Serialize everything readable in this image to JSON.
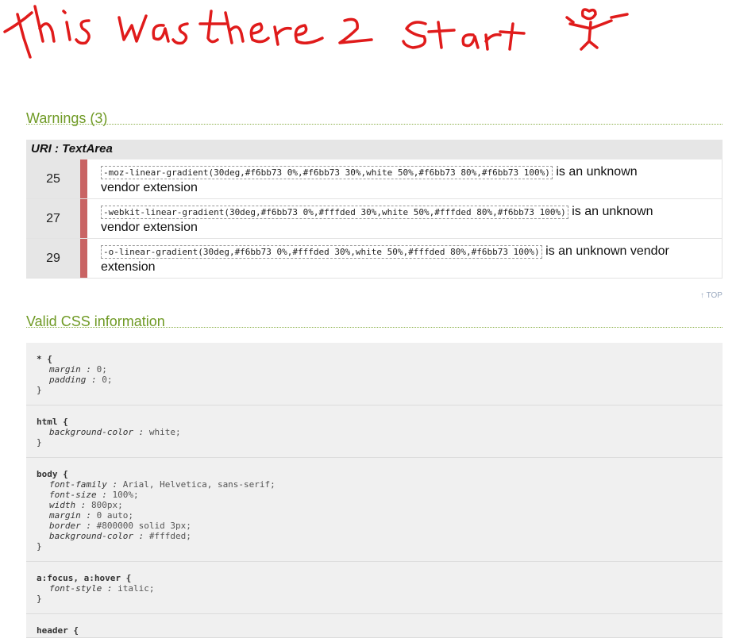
{
  "handwriting": {
    "text": "this was there 2 start"
  },
  "warnings": {
    "title": "Warnings (3)",
    "uri_label": "URI : TextArea",
    "rows": [
      {
        "line": "25",
        "code": "-moz-linear-gradient(30deg,#f6bb73 0%,#f6bb73 30%,white 50%,#f6bb73 80%,#f6bb73 100%)",
        "text_a": " is an unknown",
        "text_b": "vendor extension"
      },
      {
        "line": "27",
        "code": "-webkit-linear-gradient(30deg,#f6bb73 0%,#fffded 30%,white 50%,#fffded 80%,#f6bb73 100%)",
        "text_a": " is an unknown",
        "text_b": "vendor extension"
      },
      {
        "line": "29",
        "code": "-o-linear-gradient(30deg,#f6bb73 0%,#fffded 30%,white 50%,#fffded 80%,#f6bb73 100%)",
        "text_a": " is an unknown vendor",
        "text_b": "extension"
      }
    ]
  },
  "top_link": "↑ TOP",
  "valid": {
    "title": "Valid CSS information",
    "rules": [
      {
        "selector": "* {",
        "decls": [
          {
            "p": "margin",
            "v": "0;"
          },
          {
            "p": "padding",
            "v": "0;"
          }
        ],
        "close": "}"
      },
      {
        "selector": "html {",
        "decls": [
          {
            "p": "background-color",
            "v": "white;"
          }
        ],
        "close": "}"
      },
      {
        "selector": "body {",
        "decls": [
          {
            "p": "font-family",
            "v": "Arial, Helvetica, sans-serif;"
          },
          {
            "p": "font-size",
            "v": "100%;"
          },
          {
            "p": "width",
            "v": "800px;"
          },
          {
            "p": "margin",
            "v": "0 auto;"
          },
          {
            "p": "border",
            "v": "#800000 solid 3px;"
          },
          {
            "p": "background-color",
            "v": "#fffded;"
          }
        ],
        "close": "}"
      },
      {
        "selector": "a:focus, a:hover {",
        "decls": [
          {
            "p": "font-style",
            "v": "italic;"
          }
        ],
        "close": "}"
      },
      {
        "selector": "header {",
        "decls": [],
        "close": ""
      }
    ]
  },
  "colors": {
    "accent_green": "#6f9a25",
    "warning_bar": "#c96464",
    "handwriting": "#e01b1b"
  }
}
